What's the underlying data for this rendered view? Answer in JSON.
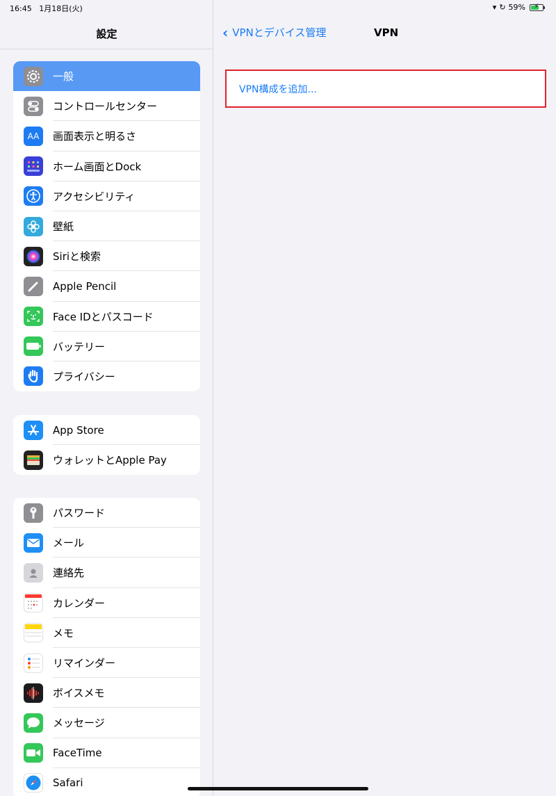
{
  "status": {
    "time": "16:45",
    "date": "1月18日(火)",
    "battery": "59%"
  },
  "sidebar": {
    "title": "設定",
    "groups": [
      {
        "items": [
          {
            "label": "一般",
            "icon": "gear-icon",
            "color": "#8e8e93",
            "selected": true
          },
          {
            "label": "コントロールセンター",
            "icon": "toggles-icon",
            "color": "#8e8e93"
          },
          {
            "label": "画面表示と明るさ",
            "icon": "text-size-icon",
            "color": "#1e7cf2"
          },
          {
            "label": "ホーム画面とDock",
            "icon": "home-grid-icon",
            "color": "#3a3fd8"
          },
          {
            "label": "アクセシビリティ",
            "icon": "accessibility-icon",
            "color": "#1e7cf2"
          },
          {
            "label": "壁紙",
            "icon": "flower-icon",
            "color": "#34aadc"
          },
          {
            "label": "Siriと検索",
            "icon": "siri-icon",
            "color": "#222222"
          },
          {
            "label": "Apple Pencil",
            "icon": "pencil-icon",
            "color": "#8e8e93"
          },
          {
            "label": "Face IDとパスコード",
            "icon": "face-id-icon",
            "color": "#34c759"
          },
          {
            "label": "バッテリー",
            "icon": "battery-icon",
            "color": "#34c759"
          },
          {
            "label": "プライバシー",
            "icon": "hand-icon",
            "color": "#1e7cf2"
          }
        ]
      },
      {
        "items": [
          {
            "label": "App Store",
            "icon": "app-store-icon",
            "color": "#1e8ff5"
          },
          {
            "label": "ウォレットとApple Pay",
            "icon": "wallet-icon",
            "color": "#222222"
          }
        ]
      },
      {
        "items": [
          {
            "label": "パスワード",
            "icon": "key-icon",
            "color": "#8e8e93"
          },
          {
            "label": "メール",
            "icon": "mail-icon",
            "color": "#1e8ff5"
          },
          {
            "label": "連絡先",
            "icon": "contacts-icon",
            "color": "#b0b0b5"
          },
          {
            "label": "カレンダー",
            "icon": "calendar-icon",
            "color": "#ffffff"
          },
          {
            "label": "メモ",
            "icon": "notes-icon",
            "color": "#ffffff"
          },
          {
            "label": "リマインダー",
            "icon": "reminders-icon",
            "color": "#ffffff"
          },
          {
            "label": "ボイスメモ",
            "icon": "voice-memo-icon",
            "color": "#1c1c1e"
          },
          {
            "label": "メッセージ",
            "icon": "messages-icon",
            "color": "#34c759"
          },
          {
            "label": "FaceTime",
            "icon": "facetime-icon",
            "color": "#34c759"
          },
          {
            "label": "Safari",
            "icon": "safari-icon",
            "color": "#1e8ff5"
          }
        ]
      }
    ]
  },
  "detail": {
    "back_label": "VPNとデバイス管理",
    "title": "VPN",
    "add_vpn_label": "VPN構成を追加..."
  },
  "colors": {
    "accent": "#1a7cf5",
    "highlight_border": "#e1212b",
    "selected_row": "#5899f4"
  }
}
